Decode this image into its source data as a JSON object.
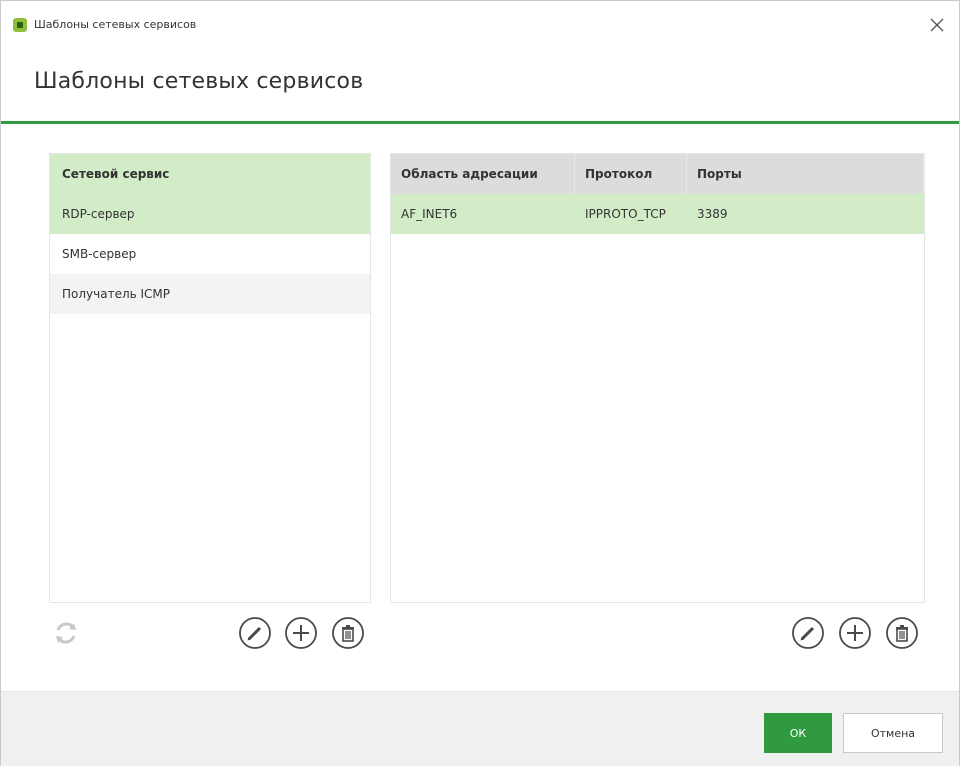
{
  "window": {
    "title": "Шаблоны сетевых сервисов"
  },
  "header": {
    "title": "Шаблоны сетевых сервисов"
  },
  "services": {
    "column_header": "Сетевой сервис",
    "items": [
      {
        "label": "RDP-сервер",
        "selected": true
      },
      {
        "label": "SMB-сервер",
        "selected": false
      },
      {
        "label": "Получатель ICMP",
        "selected": false
      }
    ]
  },
  "details": {
    "columns": [
      "Область адресации",
      "Протокол",
      "Порты"
    ],
    "rows": [
      {
        "address_family": "AF_INET6",
        "protocol": "IPPROTO_TCP",
        "ports": "3389"
      }
    ]
  },
  "icons": {
    "refresh": "refresh-icon",
    "edit": "pencil-icon",
    "add": "plus-icon",
    "delete": "trash-icon",
    "close": "close-icon"
  },
  "footer": {
    "ok_label": "ОК",
    "cancel_label": "Отмена"
  },
  "colors": {
    "accent": "#2f9a3f",
    "selection": "#d2ecc8",
    "table_header": "#dcdcdc"
  }
}
